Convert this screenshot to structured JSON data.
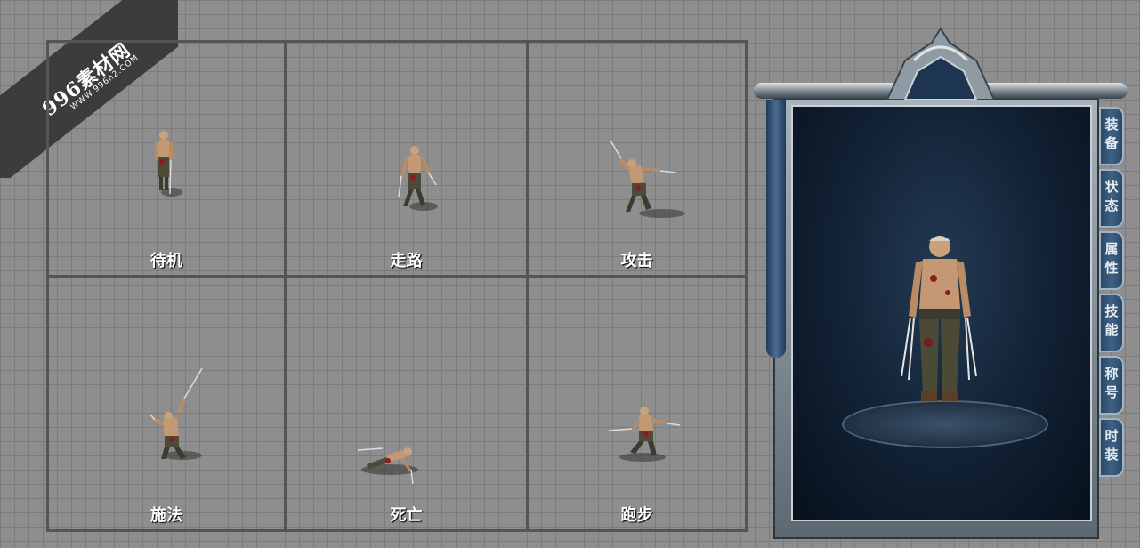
{
  "watermark": {
    "main": "996素材网",
    "sub": "WWW.996n2.COM"
  },
  "animations": [
    {
      "label": "待机"
    },
    {
      "label": "走路"
    },
    {
      "label": "攻击"
    },
    {
      "label": "施法"
    },
    {
      "label": "死亡"
    },
    {
      "label": "跑步"
    }
  ],
  "character_panel": {
    "tabs": [
      {
        "label": "装备"
      },
      {
        "label": "状态"
      },
      {
        "label": "属性"
      },
      {
        "label": "技能"
      },
      {
        "label": "称号"
      },
      {
        "label": "时装"
      }
    ]
  },
  "colors": {
    "grid_background": "#8e8e8e",
    "panel_dark": "#112033",
    "tab_fill": "#3e6285",
    "frame_silver": "#a9b3bb"
  }
}
